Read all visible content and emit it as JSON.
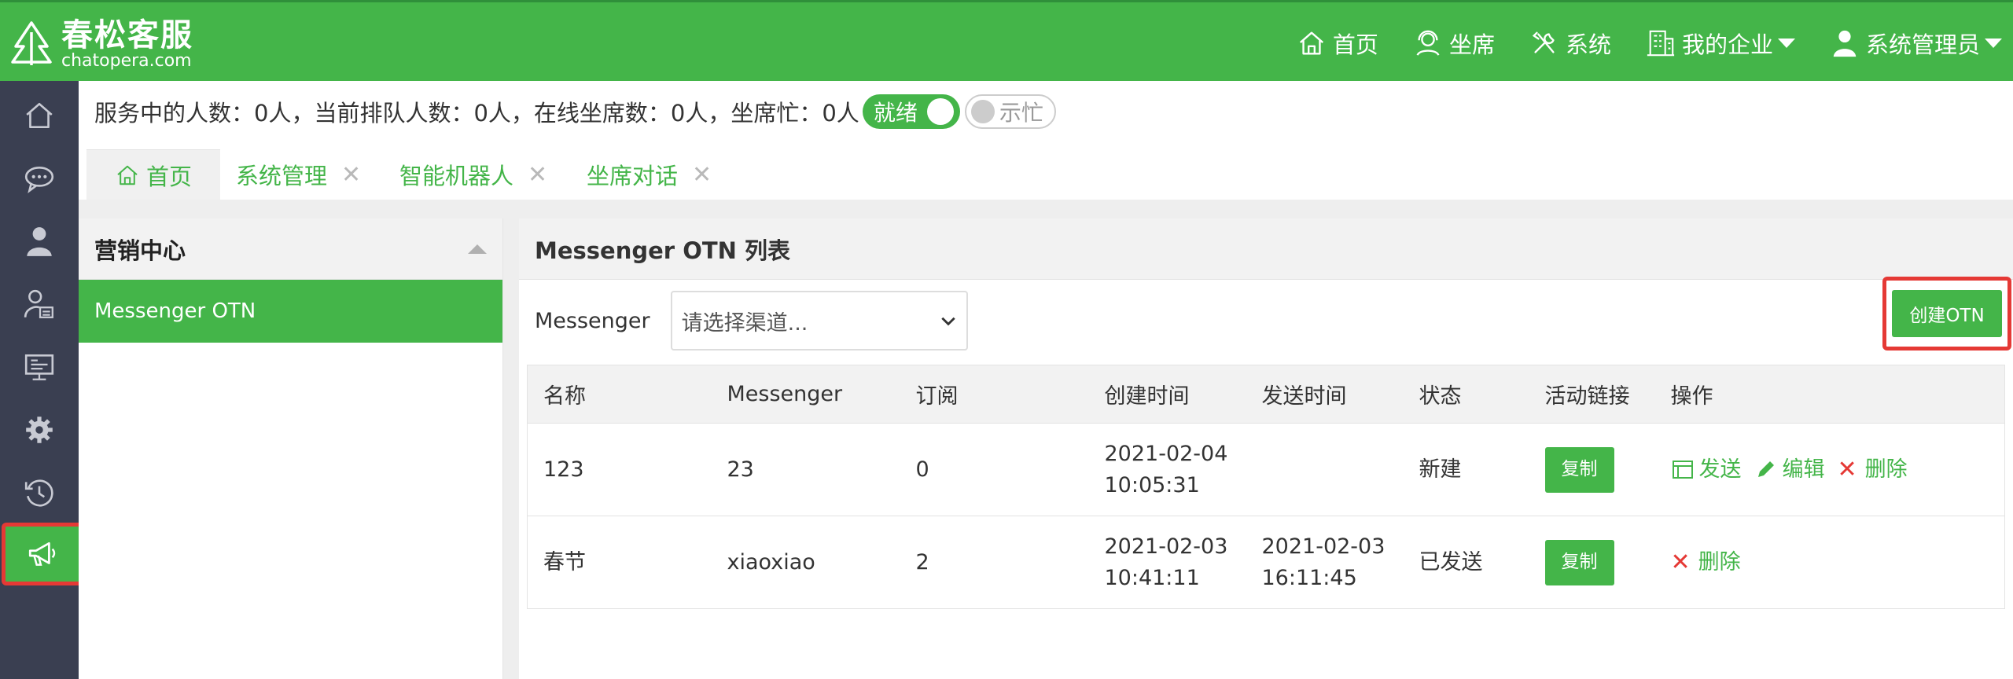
{
  "app": {
    "brand_cn": "春松客服",
    "brand_en": "chatopera.com"
  },
  "topnav": [
    {
      "label": "首页",
      "icon": "home-icon"
    },
    {
      "label": "坐席",
      "icon": "headset-icon"
    },
    {
      "label": "系统",
      "icon": "tools-icon"
    },
    {
      "label": "我的企业",
      "icon": "building-icon"
    },
    {
      "label": "系统管理员",
      "icon": "user-icon"
    }
  ],
  "status": {
    "text": "服务中的人数：0人，当前排队人数：0人，在线坐席数：0人，坐席忙：0人",
    "ready_label": "就绪",
    "busy_label": "示忙"
  },
  "tabs": [
    {
      "label": "首页"
    },
    {
      "label": "系统管理"
    },
    {
      "label": "智能机器人"
    },
    {
      "label": "坐席对话"
    }
  ],
  "left_panel": {
    "title": "营销中心",
    "items": [
      "Messenger OTN"
    ]
  },
  "main": {
    "title": "Messenger OTN 列表",
    "filter_label": "Messenger",
    "select_placeholder": "请选择渠道...",
    "create_label": "创建OTN",
    "columns": [
      "名称",
      "Messenger",
      "订阅",
      "创建时间",
      "发送时间",
      "状态",
      "活动链接",
      "操作"
    ],
    "rows": [
      {
        "name": "123",
        "messenger": "23",
        "subs": "0",
        "created_date": "2021-02-04",
        "created_time": "10:05:31",
        "sent_date": "",
        "sent_time": "",
        "status": "新建",
        "copy": "复制",
        "send": "发送",
        "edit": "编辑",
        "delete": "删除"
      },
      {
        "name": "春节",
        "messenger": "xiaoxiao",
        "subs": "2",
        "created_date": "2021-02-03",
        "created_time": "10:41:11",
        "sent_date": "2021-02-03",
        "sent_time": "16:11:45",
        "status": "已发送",
        "copy": "复制",
        "delete": "删除"
      }
    ]
  },
  "colors": {
    "brand_green": "#44b549",
    "sidebar_dark": "#3a3f51",
    "highlight_red": "#e53935"
  }
}
